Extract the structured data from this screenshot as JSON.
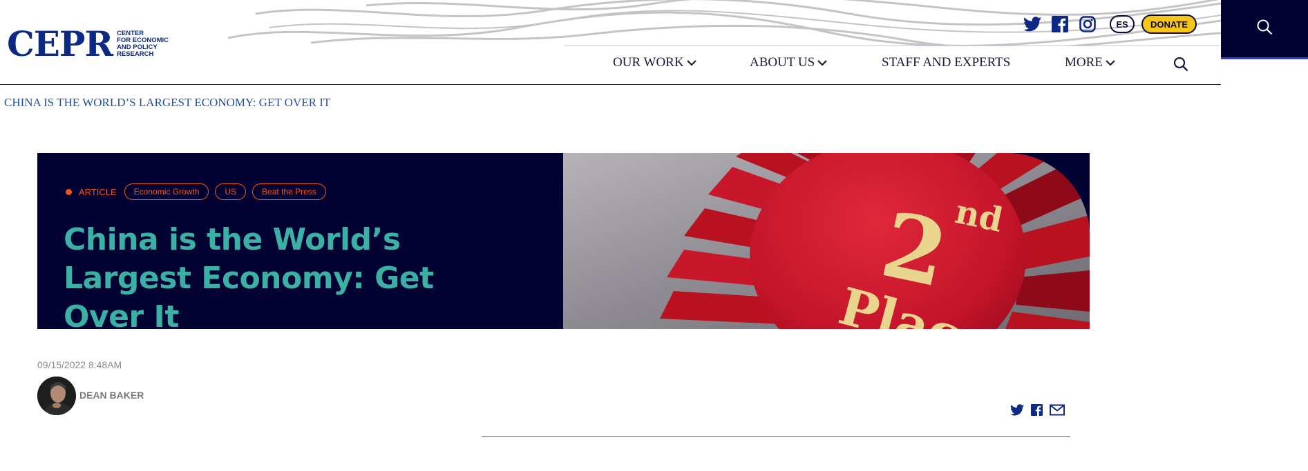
{
  "site": {
    "logo_mark": "CEPR",
    "logo_sub": [
      "CENTER",
      "FOR ECONOMIC",
      "AND POLICY",
      "RESEARCH"
    ]
  },
  "top_bar": {
    "language_label": "ES",
    "donate_label": "DONATE",
    "social_icons": [
      "twitter-icon",
      "facebook-icon",
      "instagram-icon"
    ]
  },
  "nav": {
    "items": [
      {
        "label": "OUR WORK",
        "has_dropdown": true
      },
      {
        "label": "ABOUT US",
        "has_dropdown": true
      },
      {
        "label": "STAFF AND EXPERTS",
        "has_dropdown": false
      },
      {
        "label": "MORE",
        "has_dropdown": true
      }
    ]
  },
  "breadcrumb": "CHINA IS THE WORLD’S LARGEST ECONOMY: GET OVER IT",
  "article": {
    "type": "ARTICLE",
    "tags": [
      "Economic Growth",
      "US",
      "Beat the Press"
    ],
    "title": "China is the World’s Largest Economy: Get Over It",
    "image_text": [
      "2",
      "nd",
      "Place"
    ],
    "date": "09/15/2022 8:48AM",
    "author": "DEAN BAKER"
  },
  "colors": {
    "brand_blue": "#0c2a83",
    "navy": "#020233",
    "teal_title": "#3bb0a4",
    "tag_orange": "#f2551d",
    "donate_yellow": "#f5c518",
    "breadcrumb_blue": "#1e4fa8"
  }
}
